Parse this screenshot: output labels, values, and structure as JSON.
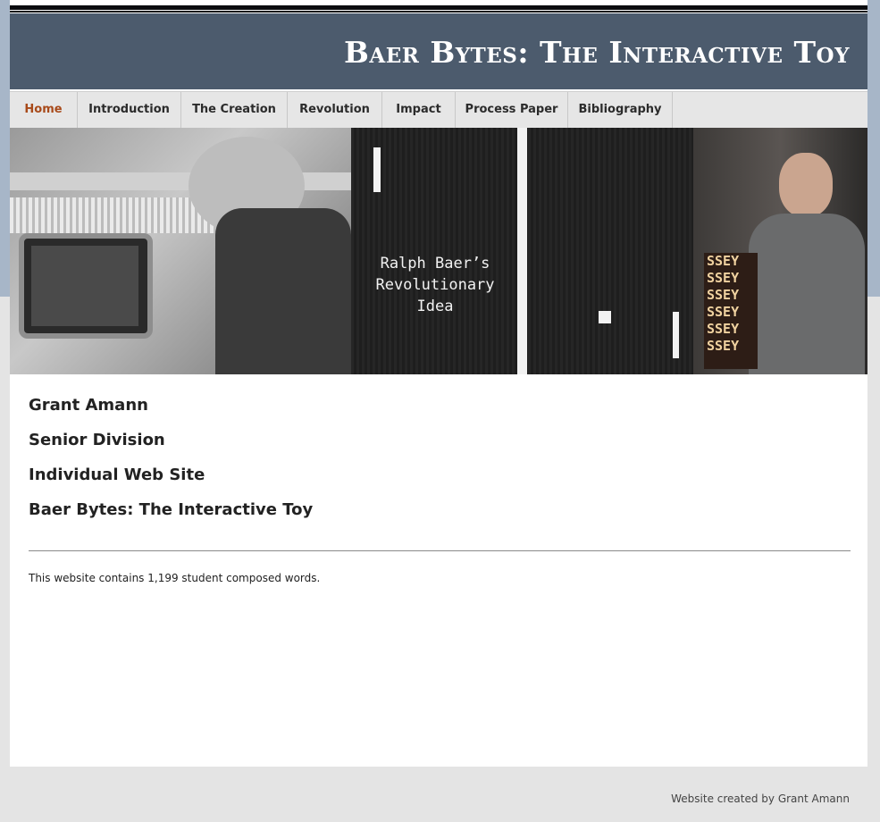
{
  "site": {
    "title": "Baer Bytes: The Interactive Toy"
  },
  "nav": {
    "items": [
      {
        "label": "Home",
        "active": true
      },
      {
        "label": "Introduction"
      },
      {
        "label": "The Creation"
      },
      {
        "label": "Revolution"
      },
      {
        "label": "Impact"
      },
      {
        "label": "Process Paper"
      },
      {
        "label": "Bibliography"
      }
    ]
  },
  "banner": {
    "caption": "Ralph Baer’s\nRevolutionary\nIdea",
    "odyssey_letters": [
      "SSEY",
      "SSEY",
      "SSEY",
      "SSEY",
      "SSEY",
      "SSEY"
    ]
  },
  "content": {
    "headings": [
      "Grant Amann",
      "Senior Division",
      "Individual Web Site",
      "Baer Bytes: The Interactive Toy"
    ],
    "word_count_text": "This website contains 1,199 student composed words."
  },
  "footer": {
    "credit": "Website created by Grant Amann"
  },
  "colors": {
    "header_bg": "#4c5b6d",
    "nav_active": "#a84a1a",
    "page_bg_top": "#a7b6c8",
    "page_bg_bottom": "#e4e4e4"
  }
}
